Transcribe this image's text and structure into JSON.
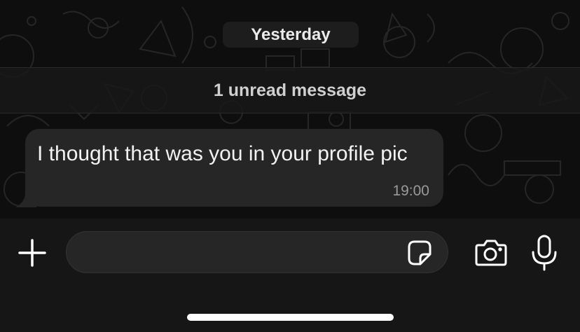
{
  "chat": {
    "date_separator": "Yesterday",
    "unread_banner": "1 unread message",
    "messages": [
      {
        "text": "I thought that was you in your profile pic",
        "time": "19:00",
        "direction": "incoming"
      }
    ]
  },
  "composer": {
    "placeholder": "",
    "icons": {
      "attach": "plus-icon",
      "sticker": "sticker-icon",
      "camera": "camera-icon",
      "voice": "microphone-icon"
    }
  },
  "colors": {
    "background": "#0e0e0e",
    "bubble": "#262626",
    "text": "#f2f2f2",
    "timestamp": "#9a9a9a"
  }
}
